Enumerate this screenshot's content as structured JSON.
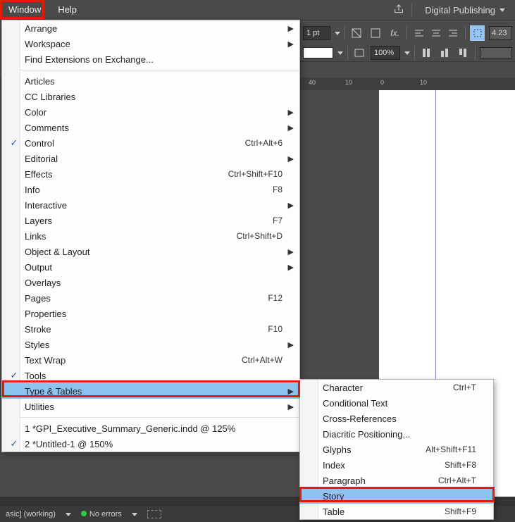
{
  "menubar": {
    "window": "Window",
    "help": "Help",
    "workspace": "Digital Publishing"
  },
  "toolbar": {
    "stroke": "1 pt",
    "zoom": "100%",
    "coord": "4.23"
  },
  "ruler": {
    "t1": "40",
    "t2": "10",
    "t3": "0",
    "t4": "10"
  },
  "status": {
    "doc": "asic]  (working)",
    "errors": "No errors"
  },
  "windowMenu": [
    {
      "label": "Arrange",
      "arrow": true
    },
    {
      "label": "Workspace",
      "arrow": true
    },
    {
      "label": "Find Extensions on Exchange..."
    },
    {
      "sep": true
    },
    {
      "label": "Articles"
    },
    {
      "label": "CC Libraries"
    },
    {
      "label": "Color",
      "arrow": true
    },
    {
      "label": "Comments",
      "arrow": true
    },
    {
      "label": "Control",
      "check": true,
      "shortcut": "Ctrl+Alt+6"
    },
    {
      "label": "Editorial",
      "arrow": true
    },
    {
      "label": "Effects",
      "shortcut": "Ctrl+Shift+F10"
    },
    {
      "label": "Info",
      "shortcut": "F8"
    },
    {
      "label": "Interactive",
      "arrow": true
    },
    {
      "label": "Layers",
      "shortcut": "F7"
    },
    {
      "label": "Links",
      "shortcut": "Ctrl+Shift+D"
    },
    {
      "label": "Object & Layout",
      "arrow": true
    },
    {
      "label": "Output",
      "arrow": true
    },
    {
      "label": "Overlays"
    },
    {
      "label": "Pages",
      "shortcut": "F12"
    },
    {
      "label": "Properties"
    },
    {
      "label": "Stroke",
      "shortcut": "F10"
    },
    {
      "label": "Styles",
      "arrow": true
    },
    {
      "label": "Text Wrap",
      "shortcut": "Ctrl+Alt+W"
    },
    {
      "label": "Tools",
      "check": true
    },
    {
      "label": "Type & Tables",
      "arrow": true,
      "highlight": true
    },
    {
      "label": "Utilities",
      "arrow": true
    },
    {
      "sep": true
    },
    {
      "label": "1 *GPI_Executive_Summary_Generic.indd @ 125%"
    },
    {
      "label": "2 *Untitled-1 @ 150%",
      "check": true
    }
  ],
  "submenu": [
    {
      "label": "Character",
      "shortcut": "Ctrl+T"
    },
    {
      "label": "Conditional Text"
    },
    {
      "label": "Cross-References"
    },
    {
      "label": "Diacritic Positioning..."
    },
    {
      "label": "Glyphs",
      "shortcut": "Alt+Shift+F11"
    },
    {
      "label": "Index",
      "shortcut": "Shift+F8"
    },
    {
      "label": "Paragraph",
      "shortcut": "Ctrl+Alt+T"
    },
    {
      "label": "Story",
      "highlight": true
    },
    {
      "label": "Table",
      "shortcut": "Shift+F9"
    }
  ]
}
